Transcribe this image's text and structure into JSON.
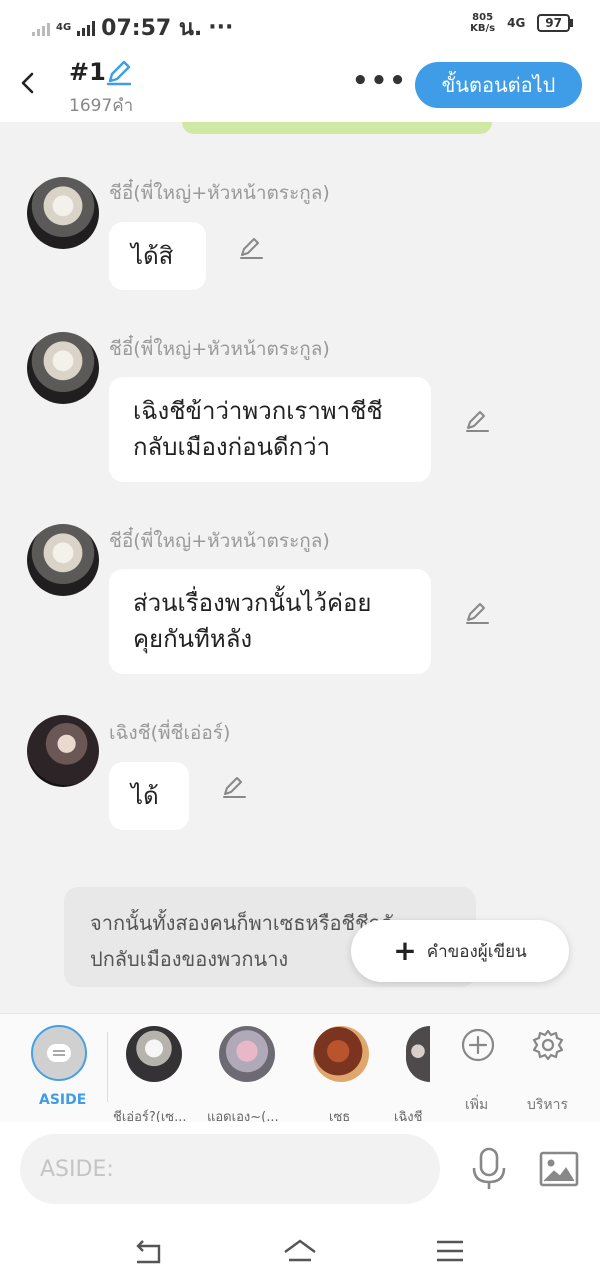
{
  "status": {
    "signal": "4G",
    "time": "07:57 น.",
    "dots": "···",
    "speed_top": "805",
    "speed_bottom": "KB/s",
    "net2": "4G",
    "battery": "97"
  },
  "header": {
    "title": "#1",
    "word_count": "1697คำ",
    "next_button": "ขั้นตอนต่อไป"
  },
  "messages": [
    {
      "speaker": "ชีอี๋(พี่ใหญ่+หัวหน้าตระกูล)",
      "lines": [
        "ได้สิ"
      ]
    },
    {
      "speaker": "ชีอี๋(พี่ใหญ่+หัวหน้าตระกูล)",
      "lines": [
        "เฉิงชีข้าว่าพวกเราพาชีชี",
        "กลับเมืองก่อนดีกว่า"
      ]
    },
    {
      "speaker": "ชีอี๋(พี่ใหญ่+หัวหน้าตระกูล)",
      "lines": [
        "ส่วนเรื่องพวกนั้นไว้ค่อย",
        "คุยกันทีหลัง"
      ]
    },
    {
      "speaker": "เฉิงชี(พี่ชีเอ่อร์)",
      "lines": [
        "ได้"
      ]
    }
  ],
  "narration": {
    "lines": [
      "จากนั้นทั้งสองคนก็พาเซธหรือชีชีกลั",
      "ปกลับเมืองของพวกนาง"
    ]
  },
  "author_button": {
    "label": "คำของผู้เขียน"
  },
  "characters": {
    "aside_label": "ASIDE",
    "items": [
      "ชีเอ่อร์?(เซ...",
      "แอดเอง~(...",
      "เซธ",
      "เฉิงชี"
    ],
    "add_label": "เพิ่ม",
    "manage_label": "บริหาร"
  },
  "input": {
    "placeholder": "ASIDE:"
  }
}
